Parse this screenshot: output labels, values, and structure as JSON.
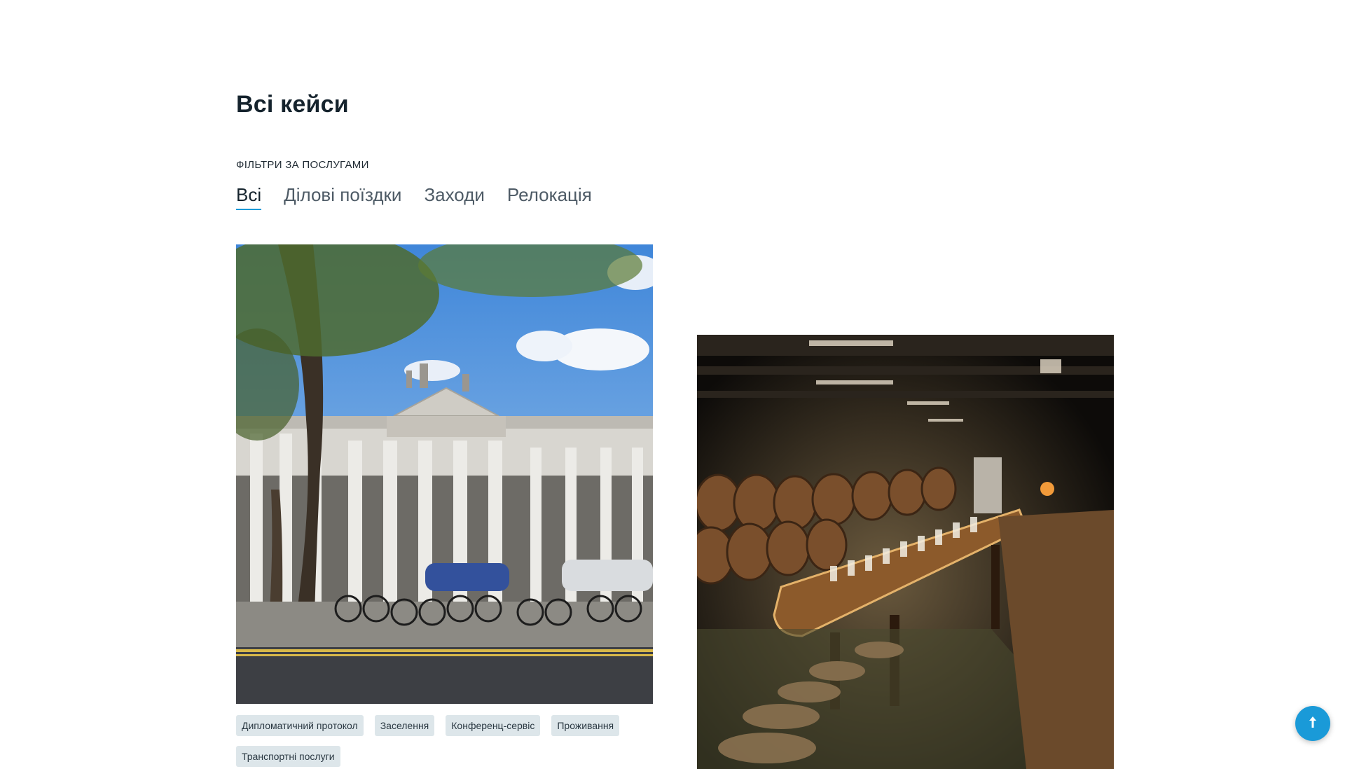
{
  "page": {
    "title": "Всі кейси",
    "filters_label": "ФІЛЬТРИ ЗА ПОСЛУГАМИ"
  },
  "tabs": [
    {
      "label": "Всі",
      "active": true
    },
    {
      "label": "Ділові поїздки",
      "active": false
    },
    {
      "label": "Заходи",
      "active": false
    },
    {
      "label": "Релокація",
      "active": false
    }
  ],
  "cases": [
    {
      "image": "building-with-columns-and-bicycles",
      "tags": [
        "Дипломатичний протокол",
        "Заселення",
        "Конференц-сервіс",
        "Проживання",
        "Транспортні послуги"
      ]
    },
    {
      "image": "wine-cellar-tasting-table",
      "tags": []
    }
  ],
  "scroll_top": {
    "icon": "arrow-up-icon"
  },
  "colors": {
    "accent": "#1a9ad8",
    "tag_bg": "#dde6ea",
    "title": "#15232d"
  }
}
